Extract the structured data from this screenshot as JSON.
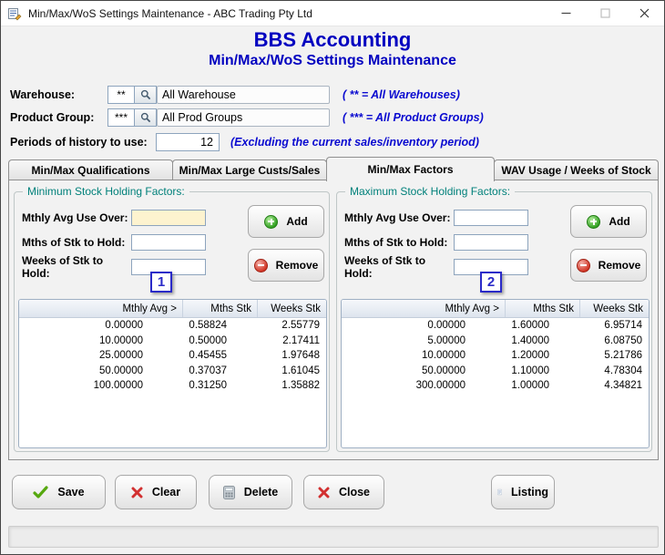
{
  "window": {
    "title": "Min/Max/WoS Settings Maintenance - ABC Trading Pty Ltd"
  },
  "header": {
    "app_title": "BBS Accounting",
    "screen_title": "Min/Max/WoS Settings Maintenance"
  },
  "filters": {
    "warehouse": {
      "label": "Warehouse:",
      "code": "**",
      "name": "All Warehouse",
      "note": "( ** = All Warehouses)"
    },
    "product_group": {
      "label": "Product Group:",
      "code": "***",
      "name": "All Prod Groups",
      "note": "( *** = All Product Groups)"
    },
    "periods": {
      "label": "Periods of history to use:",
      "value": "12",
      "note": "(Excluding the current sales/inventory period)"
    }
  },
  "tabs": {
    "qualifications": "Min/Max Qualifications",
    "large_custs": "Min/Max Large Custs/Sales",
    "factors": "Min/Max Factors",
    "wav": "WAV Usage / Weeks of Stock"
  },
  "panels": {
    "min": {
      "title": "Minimum Stock Holding Factors:",
      "avg_label": "Mthly Avg Use Over:",
      "avg_value": "",
      "mths_label": "Mths of Stk to Hold:",
      "mths_value": "",
      "weeks_label": "Weeks of Stk to Hold:",
      "weeks_value": "",
      "add": "Add",
      "remove": "Remove",
      "headers": [
        "Mthly Avg >",
        "Mths Stk",
        "Weeks Stk"
      ],
      "rows": [
        [
          "0.00000",
          "0.58824",
          "2.55779"
        ],
        [
          "10.00000",
          "0.50000",
          "2.17411"
        ],
        [
          "25.00000",
          "0.45455",
          "1.97648"
        ],
        [
          "50.00000",
          "0.37037",
          "1.61045"
        ],
        [
          "100.00000",
          "0.31250",
          "1.35882"
        ]
      ]
    },
    "max": {
      "title": "Maximum Stock Holding Factors:",
      "avg_label": "Mthly Avg Use Over:",
      "avg_value": "",
      "mths_label": "Mths of Stk to Hold:",
      "mths_value": "",
      "weeks_label": "Weeks of Stk to Hold:",
      "weeks_value": "",
      "add": "Add",
      "remove": "Remove",
      "headers": [
        "Mthly Avg >",
        "Mths Stk",
        "Weeks Stk"
      ],
      "rows": [
        [
          "0.00000",
          "1.60000",
          "6.95714"
        ],
        [
          "5.00000",
          "1.40000",
          "6.08750"
        ],
        [
          "10.00000",
          "1.20000",
          "5.21786"
        ],
        [
          "50.00000",
          "1.10000",
          "4.78304"
        ],
        [
          "300.00000",
          "1.00000",
          "4.34821"
        ]
      ]
    }
  },
  "actions": {
    "save": "Save",
    "clear": "Clear",
    "delete": "Delete",
    "close": "Close",
    "listing": "Listing"
  },
  "annotations": {
    "marker1": "1",
    "marker2": "2"
  },
  "theme": {
    "heading_blue": "#0000c0",
    "note_blue": "#0a0ad0",
    "group_title_teal": "#00807a",
    "marker_blue": "#2a2ac8",
    "add_green": "#2f9e1f",
    "remove_red": "#d03020",
    "table_header_bg": "#dde4ee",
    "focused_input_cream": "#fdf3cf"
  }
}
